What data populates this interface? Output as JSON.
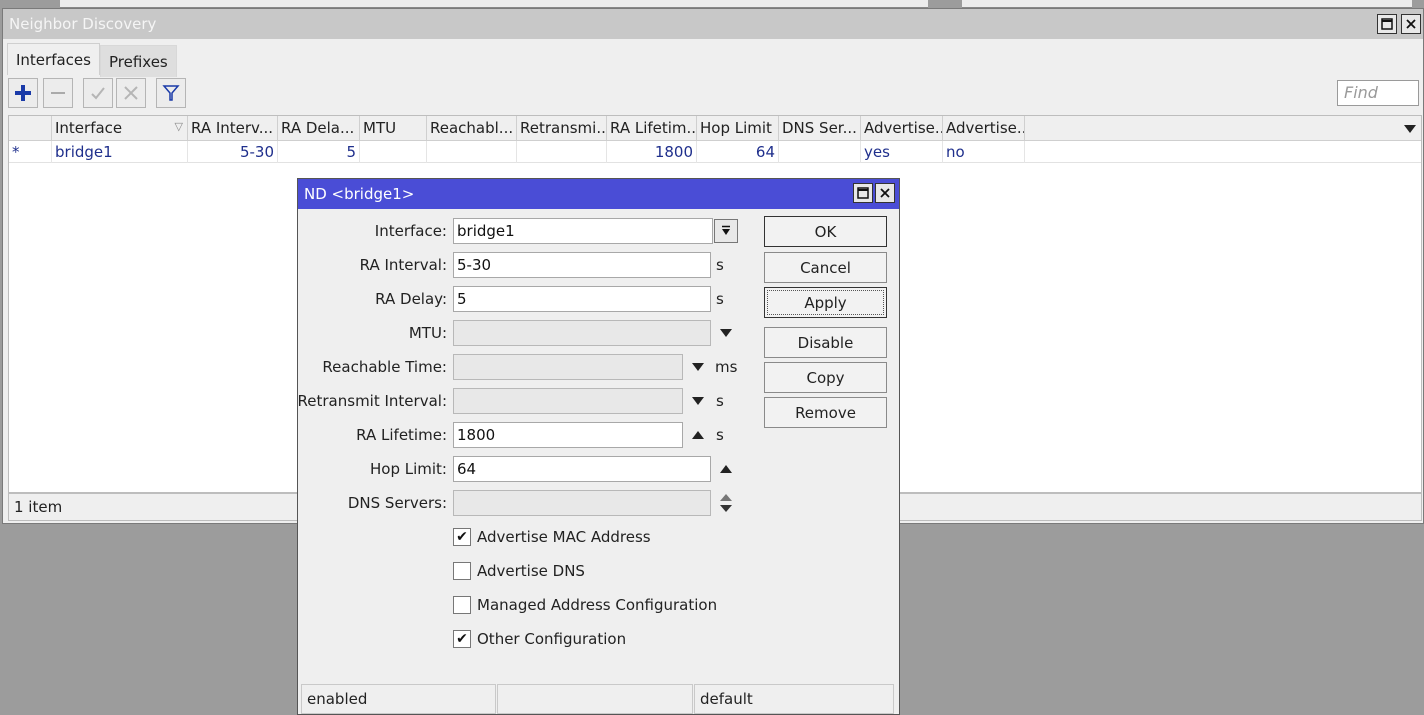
{
  "main_window": {
    "title": "Neighbor Discovery",
    "tabs": [
      {
        "label": "Interfaces"
      },
      {
        "label": "Prefixes"
      }
    ],
    "find_placeholder": "Find",
    "columns": [
      "",
      "Interface",
      "RA Interv...",
      "RA Dela...",
      "MTU",
      "Reachabl...",
      "Retransmi...",
      "RA Lifetim...",
      "Hop Limit",
      "DNS Ser...",
      "Advertise...",
      "Advertise..."
    ],
    "rows": [
      {
        "flag": "*",
        "interface": "bridge1",
        "ra_interval": "5-30",
        "ra_delay": "5",
        "mtu": "",
        "reachable": "",
        "retransmit": "",
        "ra_lifetime": "1800",
        "hop_limit": "64",
        "dns_servers": "",
        "advertise_mac": "yes",
        "advertise_dns": "no"
      }
    ],
    "status": "1 item"
  },
  "dialog": {
    "title": "ND <bridge1>",
    "fields": {
      "interface": {
        "label": "Interface:",
        "value": "bridge1"
      },
      "ra_interval": {
        "label": "RA Interval:",
        "value": "5-30",
        "unit": "s"
      },
      "ra_delay": {
        "label": "RA Delay:",
        "value": "5",
        "unit": "s"
      },
      "mtu": {
        "label": "MTU:",
        "value": ""
      },
      "reachable_time": {
        "label": "Reachable Time:",
        "value": "",
        "unit": "ms"
      },
      "retransmit_interval": {
        "label": "Retransmit Interval:",
        "value": "",
        "unit": "s"
      },
      "ra_lifetime": {
        "label": "RA Lifetime:",
        "value": "1800",
        "unit": "s"
      },
      "hop_limit": {
        "label": "Hop Limit:",
        "value": "64"
      },
      "dns_servers": {
        "label": "DNS Servers:",
        "value": ""
      }
    },
    "checkboxes": [
      {
        "label": "Advertise MAC Address",
        "checked": true
      },
      {
        "label": "Advertise DNS",
        "checked": false
      },
      {
        "label": "Managed Address Configuration",
        "checked": false
      },
      {
        "label": "Other Configuration",
        "checked": true
      }
    ],
    "buttons": {
      "ok": "OK",
      "cancel": "Cancel",
      "apply": "Apply",
      "disable": "Disable",
      "copy": "Copy",
      "remove": "Remove"
    },
    "status": {
      "left": "enabled",
      "middle": "",
      "right": "default"
    }
  },
  "colors": {
    "dialog_title": "#4a4dd6",
    "row_text": "#1f2f8c",
    "add_icon": "#1a3aa8"
  }
}
